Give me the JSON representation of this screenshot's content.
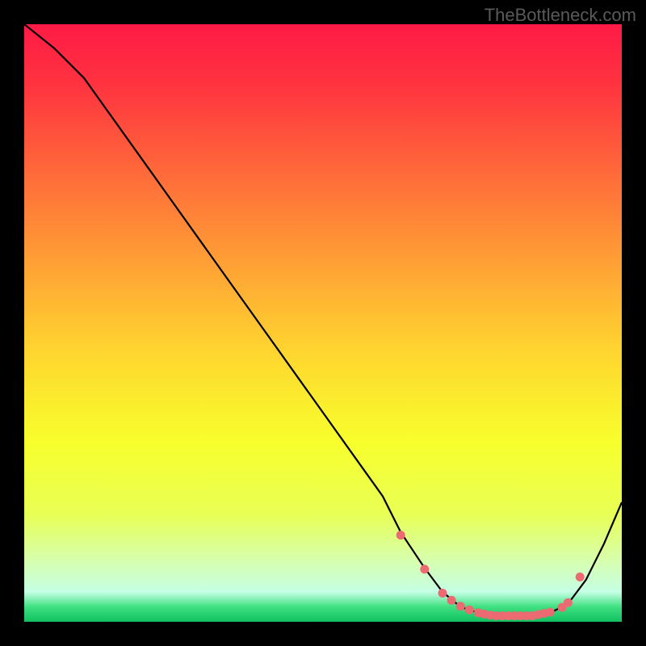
{
  "watermark": "TheBottleneck.com",
  "chart_data": {
    "type": "line",
    "title": "",
    "xlabel": "",
    "ylabel": "",
    "xlim": [
      0,
      100
    ],
    "ylim": [
      0,
      100
    ],
    "grid": false,
    "legend": false,
    "background_gradient": {
      "direction": "vertical",
      "stops": [
        {
          "pos": 0.0,
          "color": "#ff1a45"
        },
        {
          "pos": 0.1,
          "color": "#ff3340"
        },
        {
          "pos": 0.25,
          "color": "#ff6a3a"
        },
        {
          "pos": 0.4,
          "color": "#ffa035"
        },
        {
          "pos": 0.55,
          "color": "#ffd62f"
        },
        {
          "pos": 0.7,
          "color": "#f7ff2c"
        },
        {
          "pos": 0.82,
          "color": "#e8ff55"
        },
        {
          "pos": 0.9,
          "color": "#d6ffb0"
        },
        {
          "pos": 0.95,
          "color": "#c5ffe5"
        },
        {
          "pos": 0.975,
          "color": "#40e080"
        },
        {
          "pos": 1.0,
          "color": "#10c060"
        }
      ]
    },
    "series": [
      {
        "name": "bottleneck-curve",
        "color": "#000000",
        "stroke_width": 2.2,
        "x": [
          0,
          5,
          10,
          15,
          20,
          25,
          30,
          35,
          40,
          45,
          50,
          55,
          60,
          63,
          67,
          70,
          73,
          76,
          79,
          82,
          85,
          88,
          91,
          94,
          97,
          100
        ],
        "y": [
          100,
          96,
          91,
          84,
          77,
          70,
          63,
          56,
          49,
          42,
          35,
          28,
          21,
          15,
          9,
          5,
          2.5,
          1.5,
          1.0,
          1.0,
          1.0,
          1.5,
          3,
          7,
          13,
          20
        ]
      }
    ],
    "markers": {
      "name": "highlight-points",
      "color": "#ec6a71",
      "radius": 5.5,
      "x": [
        63,
        67,
        70,
        71.5,
        73,
        74.5,
        76,
        77,
        78,
        79,
        80,
        81,
        82,
        83,
        84,
        85,
        86,
        87,
        88,
        90,
        91,
        93
      ],
      "y": [
        14.5,
        8.8,
        4.8,
        3.6,
        2.6,
        2.0,
        1.5,
        1.3,
        1.1,
        1.0,
        1.0,
        1.0,
        1.0,
        1.0,
        1.0,
        1.0,
        1.2,
        1.4,
        1.6,
        2.4,
        3.2,
        7.5
      ]
    }
  }
}
